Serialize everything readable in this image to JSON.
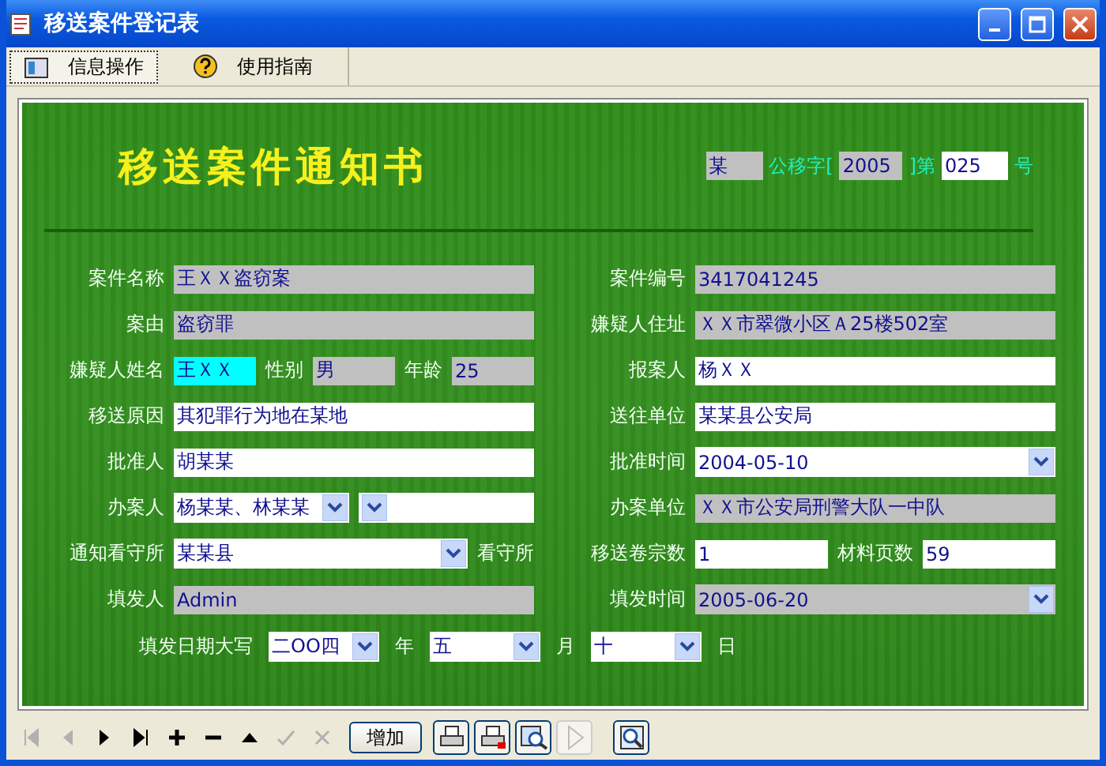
{
  "window": {
    "title": "移送案件登记表"
  },
  "tabs": [
    {
      "label": "信息操作",
      "selected": true
    },
    {
      "label": "使用指南",
      "selected": false
    }
  ],
  "form": {
    "title": "移送案件通知书",
    "doc_number": [
      {
        "kind": "field",
        "value": "某",
        "readonly": true
      },
      {
        "kind": "label",
        "text": "公移字["
      },
      {
        "kind": "field",
        "value": "2005",
        "readonly": true
      },
      {
        "kind": "label",
        "text": "]第"
      },
      {
        "kind": "field",
        "value": "025",
        "readonly": false
      },
      {
        "kind": "label",
        "text": "号"
      }
    ],
    "rows": [
      {
        "left": [
          {
            "kind": "label",
            "text": "案件名称"
          },
          {
            "kind": "field",
            "value": "王ＸＸ盗窃案",
            "readonly": true
          }
        ],
        "right": [
          {
            "kind": "label",
            "text": "案件编号"
          },
          {
            "kind": "field",
            "value": "3417041245",
            "readonly": true
          }
        ]
      },
      {
        "left": [
          {
            "kind": "label",
            "text": "案由"
          },
          {
            "kind": "field",
            "value": "盗窃罪",
            "readonly": true
          }
        ],
        "right": [
          {
            "kind": "label",
            "text": "嫌疑人住址"
          },
          {
            "kind": "field",
            "value": "ＸＸ市翠微小区Ａ25楼502室",
            "readonly": true
          }
        ]
      },
      {
        "left": [
          {
            "kind": "label",
            "text": "嫌疑人姓名"
          },
          {
            "kind": "field",
            "value": "王ＸＸ",
            "readonly": false,
            "focused": true
          },
          {
            "kind": "label",
            "text": "性别"
          },
          {
            "kind": "field",
            "value": "男",
            "readonly": true
          },
          {
            "kind": "label",
            "text": "年龄"
          },
          {
            "kind": "field",
            "value": "25",
            "readonly": true
          }
        ],
        "right": [
          {
            "kind": "label",
            "text": "报案人"
          },
          {
            "kind": "field",
            "value": "杨ＸＸ",
            "readonly": false
          }
        ]
      },
      {
        "left": [
          {
            "kind": "label",
            "text": "移送原因"
          },
          {
            "kind": "field",
            "value": "其犯罪行为地在某地",
            "readonly": false
          }
        ],
        "right": [
          {
            "kind": "label",
            "text": "送往单位"
          },
          {
            "kind": "field",
            "value": "某某县公安局",
            "readonly": false
          }
        ]
      },
      {
        "left": [
          {
            "kind": "label",
            "text": "批准人"
          },
          {
            "kind": "field",
            "value": "胡某某",
            "readonly": false
          }
        ],
        "right": [
          {
            "kind": "label",
            "text": "批准时间"
          },
          {
            "kind": "select",
            "value": "2004-05-10",
            "readonly": false
          }
        ]
      },
      {
        "left": [
          {
            "kind": "label",
            "text": "办案人"
          },
          {
            "kind": "select",
            "value": "杨某某、林某某",
            "readonly": false
          },
          {
            "kind": "select",
            "readonly": false
          }
        ],
        "right": [
          {
            "kind": "label",
            "text": "办案单位"
          },
          {
            "kind": "field",
            "value": "ＸＸ市公安局刑警大队一中队",
            "readonly": true
          }
        ]
      },
      {
        "left": [
          {
            "kind": "label",
            "text": "通知看守所"
          },
          {
            "kind": "select",
            "value": "某某县",
            "readonly": false
          },
          {
            "kind": "label",
            "text": "看守所"
          }
        ],
        "right": [
          {
            "kind": "label",
            "text": "移送卷宗数"
          },
          {
            "kind": "field",
            "value": "1",
            "readonly": false
          },
          {
            "kind": "label",
            "text": "材料页数"
          },
          {
            "kind": "field",
            "value": "59",
            "readonly": false
          }
        ]
      },
      {
        "left": [
          {
            "kind": "label",
            "text": "填发人"
          },
          {
            "kind": "field",
            "value": "Admin",
            "readonly": true
          }
        ],
        "right": [
          {
            "kind": "label",
            "text": "填发时间"
          },
          {
            "kind": "select",
            "value": "2005-06-20",
            "readonly": true
          }
        ]
      }
    ],
    "date_row": [
      {
        "kind": "label",
        "text": "填发日期大写"
      },
      {
        "kind": "select",
        "value": "二OO四",
        "readonly": false
      },
      {
        "kind": "label",
        "text": "年"
      },
      {
        "kind": "select",
        "value": "五",
        "readonly": false
      },
      {
        "kind": "label",
        "text": "月"
      },
      {
        "kind": "select",
        "value": "十",
        "readonly": false
      },
      {
        "kind": "label",
        "text": "日"
      }
    ]
  },
  "toolbar": [
    {
      "kind": "first",
      "disabled": true
    },
    {
      "kind": "prev",
      "disabled": true
    },
    {
      "kind": "next",
      "disabled": false
    },
    {
      "kind": "last",
      "disabled": false
    },
    {
      "kind": "plus",
      "disabled": false
    },
    {
      "kind": "minus",
      "disabled": false
    },
    {
      "kind": "up",
      "disabled": false
    },
    {
      "kind": "check",
      "disabled": true
    },
    {
      "kind": "cross",
      "disabled": true
    },
    {
      "kind": "text",
      "label": "增加",
      "disabled": false
    },
    {
      "kind": "print",
      "disabled": false
    },
    {
      "kind": "print-red",
      "disabled": false
    },
    {
      "kind": "preview",
      "disabled": false
    },
    {
      "kind": "play",
      "disabled": true
    },
    {
      "kind": "zoom",
      "disabled": false
    }
  ]
}
